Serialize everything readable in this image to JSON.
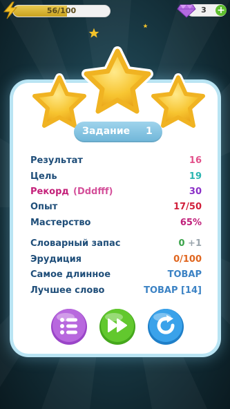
{
  "top_bar": {
    "energy_text": "56/100",
    "energy_fraction": 0.56,
    "gems_count": "3",
    "plus_label": "+"
  },
  "card": {
    "title": "Задание",
    "level": "1",
    "stars_earned": 3,
    "stats": [
      {
        "label": "Результат",
        "value": "16",
        "color": "#e2508a"
      },
      {
        "label": "Цель",
        "value": "19",
        "color": "#2bb5b0"
      },
      {
        "label": "Рекорд",
        "note": "(Dddfff)",
        "value": "30",
        "color": "#8a2fc7",
        "label_color": "#c4217a"
      },
      {
        "label": "Опыт",
        "value": "17/50",
        "color": "#d11f3a"
      },
      {
        "label": "Мастерство",
        "value": "65%",
        "color": "#c01f7a"
      }
    ],
    "words": [
      {
        "label": "Словарный запас",
        "value": "0",
        "bonus": "+1",
        "color": "#3aa34a"
      },
      {
        "label": "Эрудиция",
        "value": "0/100",
        "color": "#e0661f"
      },
      {
        "label": "Самое длинное",
        "value": "ТОВАР",
        "color": "#3b82c4"
      },
      {
        "label": "Лучшее слово",
        "value": "ТОВАР [14]",
        "color": "#3b82c4"
      }
    ]
  },
  "buttons": {
    "menu": "list-icon",
    "next": "fast-forward-icon",
    "retry": "refresh-icon"
  },
  "colors": {
    "label": "#1f4e79",
    "pill": "#7fc0df",
    "menu_btn": "#b060d8",
    "next_btn": "#5cc32a",
    "retry_btn": "#2f9ae6"
  }
}
